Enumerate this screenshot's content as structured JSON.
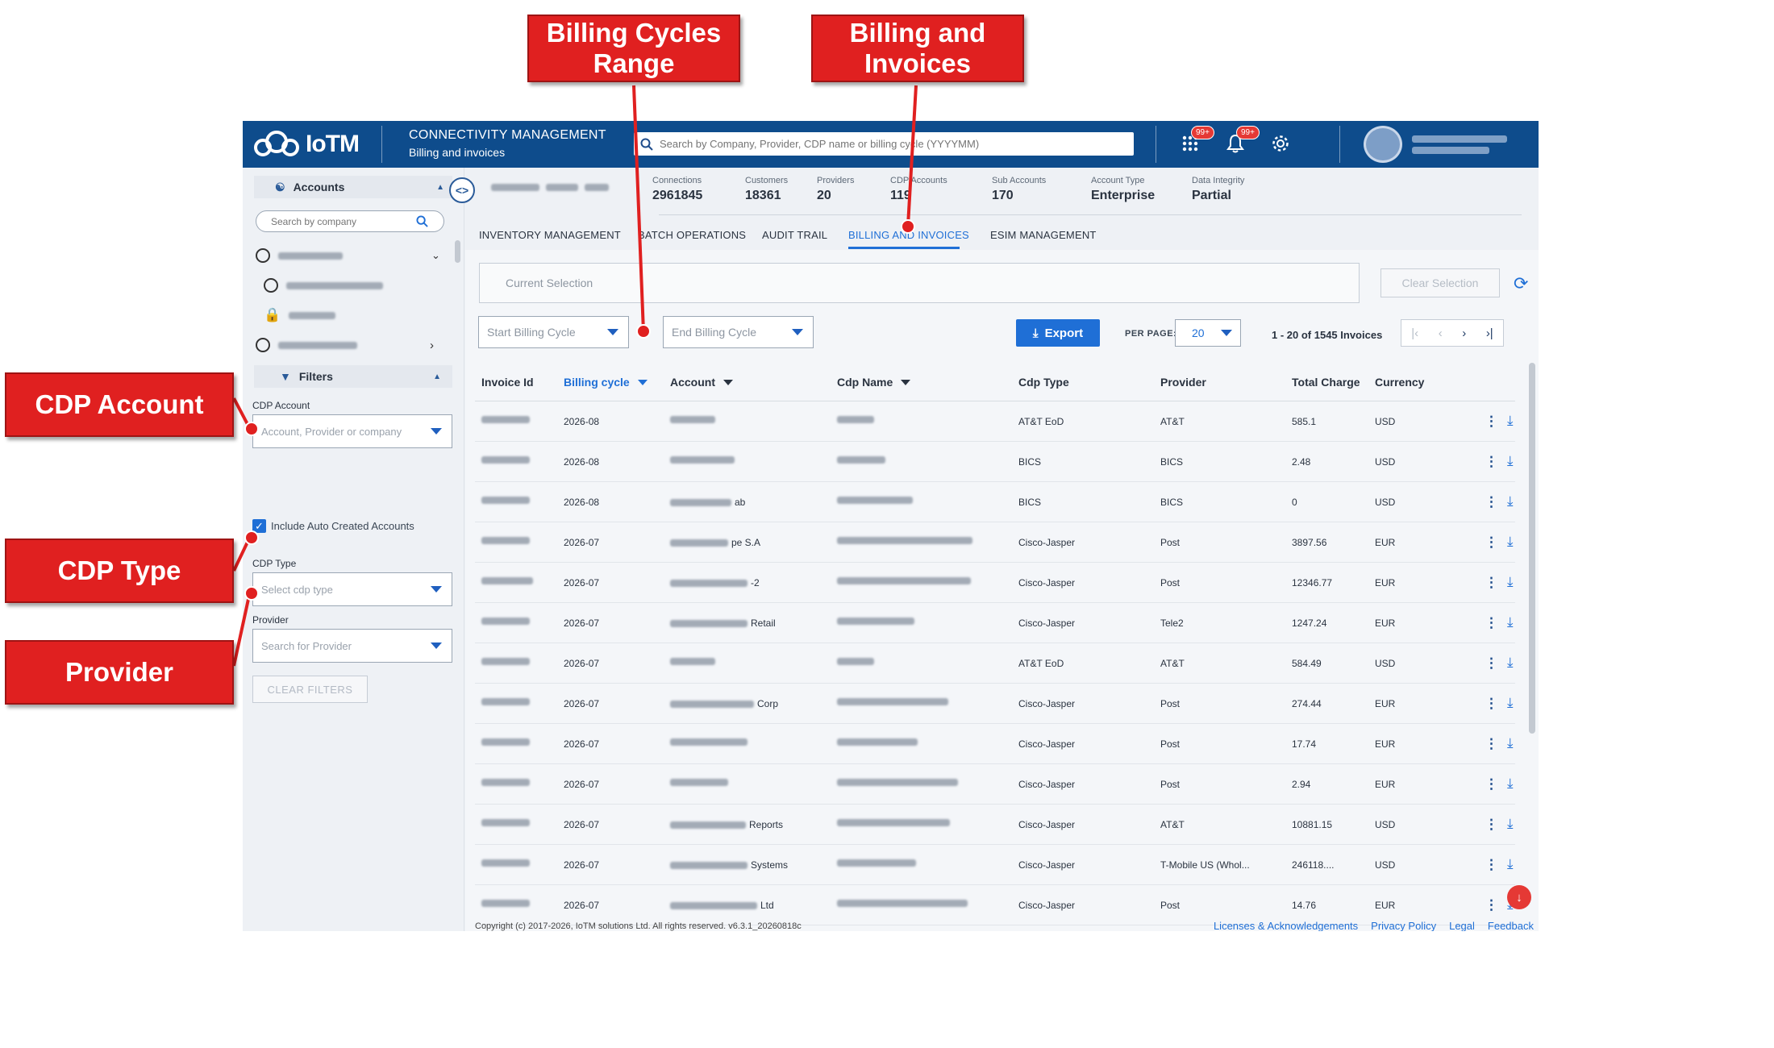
{
  "topbar": {
    "logo_text": "IoTM",
    "title": "CONNECTIVITY MANAGEMENT",
    "subtitle": "Billing and invoices",
    "search_placeholder": "Search by Company, Provider, CDP name or billing cycle (YYYYMM)",
    "apps_badge": "99+",
    "notif_badge": "99+",
    "icons": [
      "apps-grid-icon",
      "bell-icon",
      "gear-icon",
      "avatar"
    ]
  },
  "sidebar": {
    "accounts_label": "Accounts",
    "search_placeholder": "Search by company",
    "filters_label": "Filters",
    "cdp_account_label": "CDP Account",
    "cdp_account_placeholder": "Account, Provider or company",
    "include_auto_label": "Include Auto Created Accounts",
    "cdp_type_label": "CDP Type",
    "cdp_type_placeholder": "Select cdp type",
    "provider_label": "Provider",
    "provider_placeholder": "Search for Provider",
    "clear_filters": "CLEAR FILTERS"
  },
  "stats": [
    {
      "k": "Connections",
      "v": "2961845"
    },
    {
      "k": "Customers",
      "v": "18361"
    },
    {
      "k": "Providers",
      "v": "20"
    },
    {
      "k": "CDP Accounts",
      "v": "119"
    },
    {
      "k": "Sub Accounts",
      "v": "170"
    },
    {
      "k": "Account Type",
      "v": "Enterprise"
    },
    {
      "k": "Data Integrity",
      "v": "Partial"
    }
  ],
  "tabs": [
    "INVENTORY MANAGEMENT",
    "BATCH OPERATIONS",
    "AUDIT TRAIL",
    "BILLING AND INVOICES",
    "ESIM MANAGEMENT"
  ],
  "toolbar": {
    "current_selection": "Current Selection",
    "clear_selection": "Clear Selection",
    "start_cycle": "Start Billing Cycle",
    "end_cycle": "End Billing Cycle",
    "export": "Export",
    "per_page_label": "PER PAGE:",
    "per_page": "20",
    "page_info": "1 - 20 of 1545 Invoices"
  },
  "columns": [
    "Invoice Id",
    "Billing cycle",
    "Account",
    "Cdp Name",
    "Cdp Type",
    "Provider",
    "Total Charge",
    "Currency"
  ],
  "rows": [
    {
      "cycle": "2026-08",
      "account_suffix": "",
      "type": "AT&T EoD",
      "provider": "AT&T",
      "charge": "585.1",
      "currency": "USD"
    },
    {
      "cycle": "2026-08",
      "account_suffix": "",
      "type": "BICS",
      "provider": "BICS",
      "charge": "2.48",
      "currency": "USD"
    },
    {
      "cycle": "2026-08",
      "account_suffix": "ab",
      "type": "BICS",
      "provider": "BICS",
      "charge": "0",
      "currency": "USD"
    },
    {
      "cycle": "2026-07",
      "account_suffix": "pe S.A",
      "type": "Cisco-Jasper",
      "provider": "Post",
      "charge": "3897.56",
      "currency": "EUR"
    },
    {
      "cycle": "2026-07",
      "account_suffix": "-2",
      "type": "Cisco-Jasper",
      "provider": "Post",
      "charge": "12346.77",
      "currency": "EUR"
    },
    {
      "cycle": "2026-07",
      "account_suffix": "Retail",
      "type": "Cisco-Jasper",
      "provider": "Tele2",
      "charge": "1247.24",
      "currency": "EUR"
    },
    {
      "cycle": "2026-07",
      "account_suffix": "",
      "type": "AT&T EoD",
      "provider": "AT&T",
      "charge": "584.49",
      "currency": "USD"
    },
    {
      "cycle": "2026-07",
      "account_suffix": "Corp",
      "type": "Cisco-Jasper",
      "provider": "Post",
      "charge": "274.44",
      "currency": "EUR"
    },
    {
      "cycle": "2026-07",
      "account_suffix": "",
      "type": "Cisco-Jasper",
      "provider": "Post",
      "charge": "17.74",
      "currency": "EUR"
    },
    {
      "cycle": "2026-07",
      "account_suffix": "",
      "type": "Cisco-Jasper",
      "provider": "Post",
      "charge": "2.94",
      "currency": "EUR"
    },
    {
      "cycle": "2026-07",
      "account_suffix": "Reports",
      "type": "Cisco-Jasper",
      "provider": "AT&T",
      "charge": "10881.15",
      "currency": "USD"
    },
    {
      "cycle": "2026-07",
      "account_suffix": "Systems",
      "type": "Cisco-Jasper",
      "provider": "T-Mobile US (Whol...",
      "charge": "246118....",
      "currency": "USD"
    },
    {
      "cycle": "2026-07",
      "account_suffix": "Ltd",
      "type": "Cisco-Jasper",
      "provider": "Post",
      "charge": "14.76",
      "currency": "EUR"
    }
  ],
  "footer": {
    "copyright": "Copyright (c) 2017-2026, IoTM solutions Ltd. All rights reserved. v6.3.1_20260818c",
    "links": [
      "Licenses & Acknowledgements",
      "Privacy Policy",
      "Legal",
      "Feedback"
    ]
  },
  "callouts": {
    "billing_range": "Billing Cycles Range",
    "billing_invoices": "Billing and Invoices",
    "cdp_account": "CDP Account",
    "cdp_type": "CDP Type",
    "provider": "Provider"
  },
  "colors": {
    "brand": "#0e4c8c",
    "accent": "#1f6fd6",
    "callout": "#e02020"
  }
}
